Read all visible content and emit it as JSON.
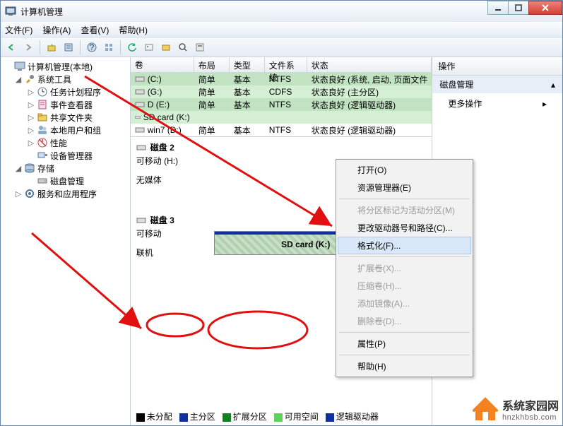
{
  "window": {
    "title": "计算机管理"
  },
  "menu": {
    "file": "文件(F)",
    "action": "操作(A)",
    "view": "查看(V)",
    "help": "帮助(H)"
  },
  "tree": {
    "root": "计算机管理(本地)",
    "systools": "系统工具",
    "sched": "任务计划程序",
    "event": "事件查看器",
    "shared": "共享文件夹",
    "users": "本地用户和组",
    "perf": "性能",
    "devmgr": "设备管理器",
    "storage": "存储",
    "diskmgmt": "磁盘管理",
    "services": "服务和应用程序"
  },
  "grid": {
    "cols": {
      "vol": "卷",
      "layout": "布局",
      "type": "类型",
      "fs": "文件系统",
      "status": "状态"
    },
    "rows": [
      {
        "vol": "(C:)",
        "layout": "简单",
        "type": "基本",
        "fs": "NTFS",
        "status": "状态良好 (系统, 启动, 页面文件",
        "selcls": "sel"
      },
      {
        "vol": "(G:)",
        "layout": "简单",
        "type": "基本",
        "fs": "CDFS",
        "status": "状态良好 (主分区)",
        "selcls": "sel2"
      },
      {
        "vol": "D (E:)",
        "layout": "简单",
        "type": "基本",
        "fs": "NTFS",
        "status": "状态良好 (逻辑驱动器)",
        "selcls": "sel"
      },
      {
        "vol": "SD card (K:)",
        "layout": "",
        "type": "",
        "fs": "",
        "status": "",
        "selcls": "sel2"
      },
      {
        "vol": "win7 (D:)",
        "layout": "简单",
        "type": "基本",
        "fs": "NTFS",
        "status": "状态良好 (逻辑驱动器)",
        "selcls": ""
      }
    ]
  },
  "disks": {
    "d2": {
      "title": "磁盘 2",
      "line1": "可移动 (H:)",
      "line2": "无媒体"
    },
    "d3": {
      "title": "磁盘 3",
      "line1": "可移动",
      "line2": "联机",
      "part": "SD card  (K:)"
    }
  },
  "legend": {
    "unalloc": "未分配",
    "primary": "主分区",
    "ext": "扩展分区",
    "free": "可用空间",
    "logical": "逻辑驱动器"
  },
  "legend_colors": {
    "unalloc": "#000000",
    "primary": "#1030a0",
    "ext": "#108020",
    "free": "#60d060",
    "logical": "#1030a0"
  },
  "actions": {
    "title": "操作",
    "section": "磁盘管理",
    "more": "更多操作"
  },
  "ctx": {
    "open": "打开(O)",
    "explorer": "资源管理器(E)",
    "markactive": "将分区标记为活动分区(M)",
    "chgletter": "更改驱动器号和路径(C)...",
    "format": "格式化(F)...",
    "extend": "扩展卷(X)...",
    "shrink": "压缩卷(H)...",
    "mirror": "添加镜像(A)...",
    "delete": "删除卷(D)...",
    "prop": "属性(P)",
    "help": "帮助(H)"
  },
  "watermark": {
    "name": "系统家园网",
    "url": "hnzkhbsb.com"
  }
}
